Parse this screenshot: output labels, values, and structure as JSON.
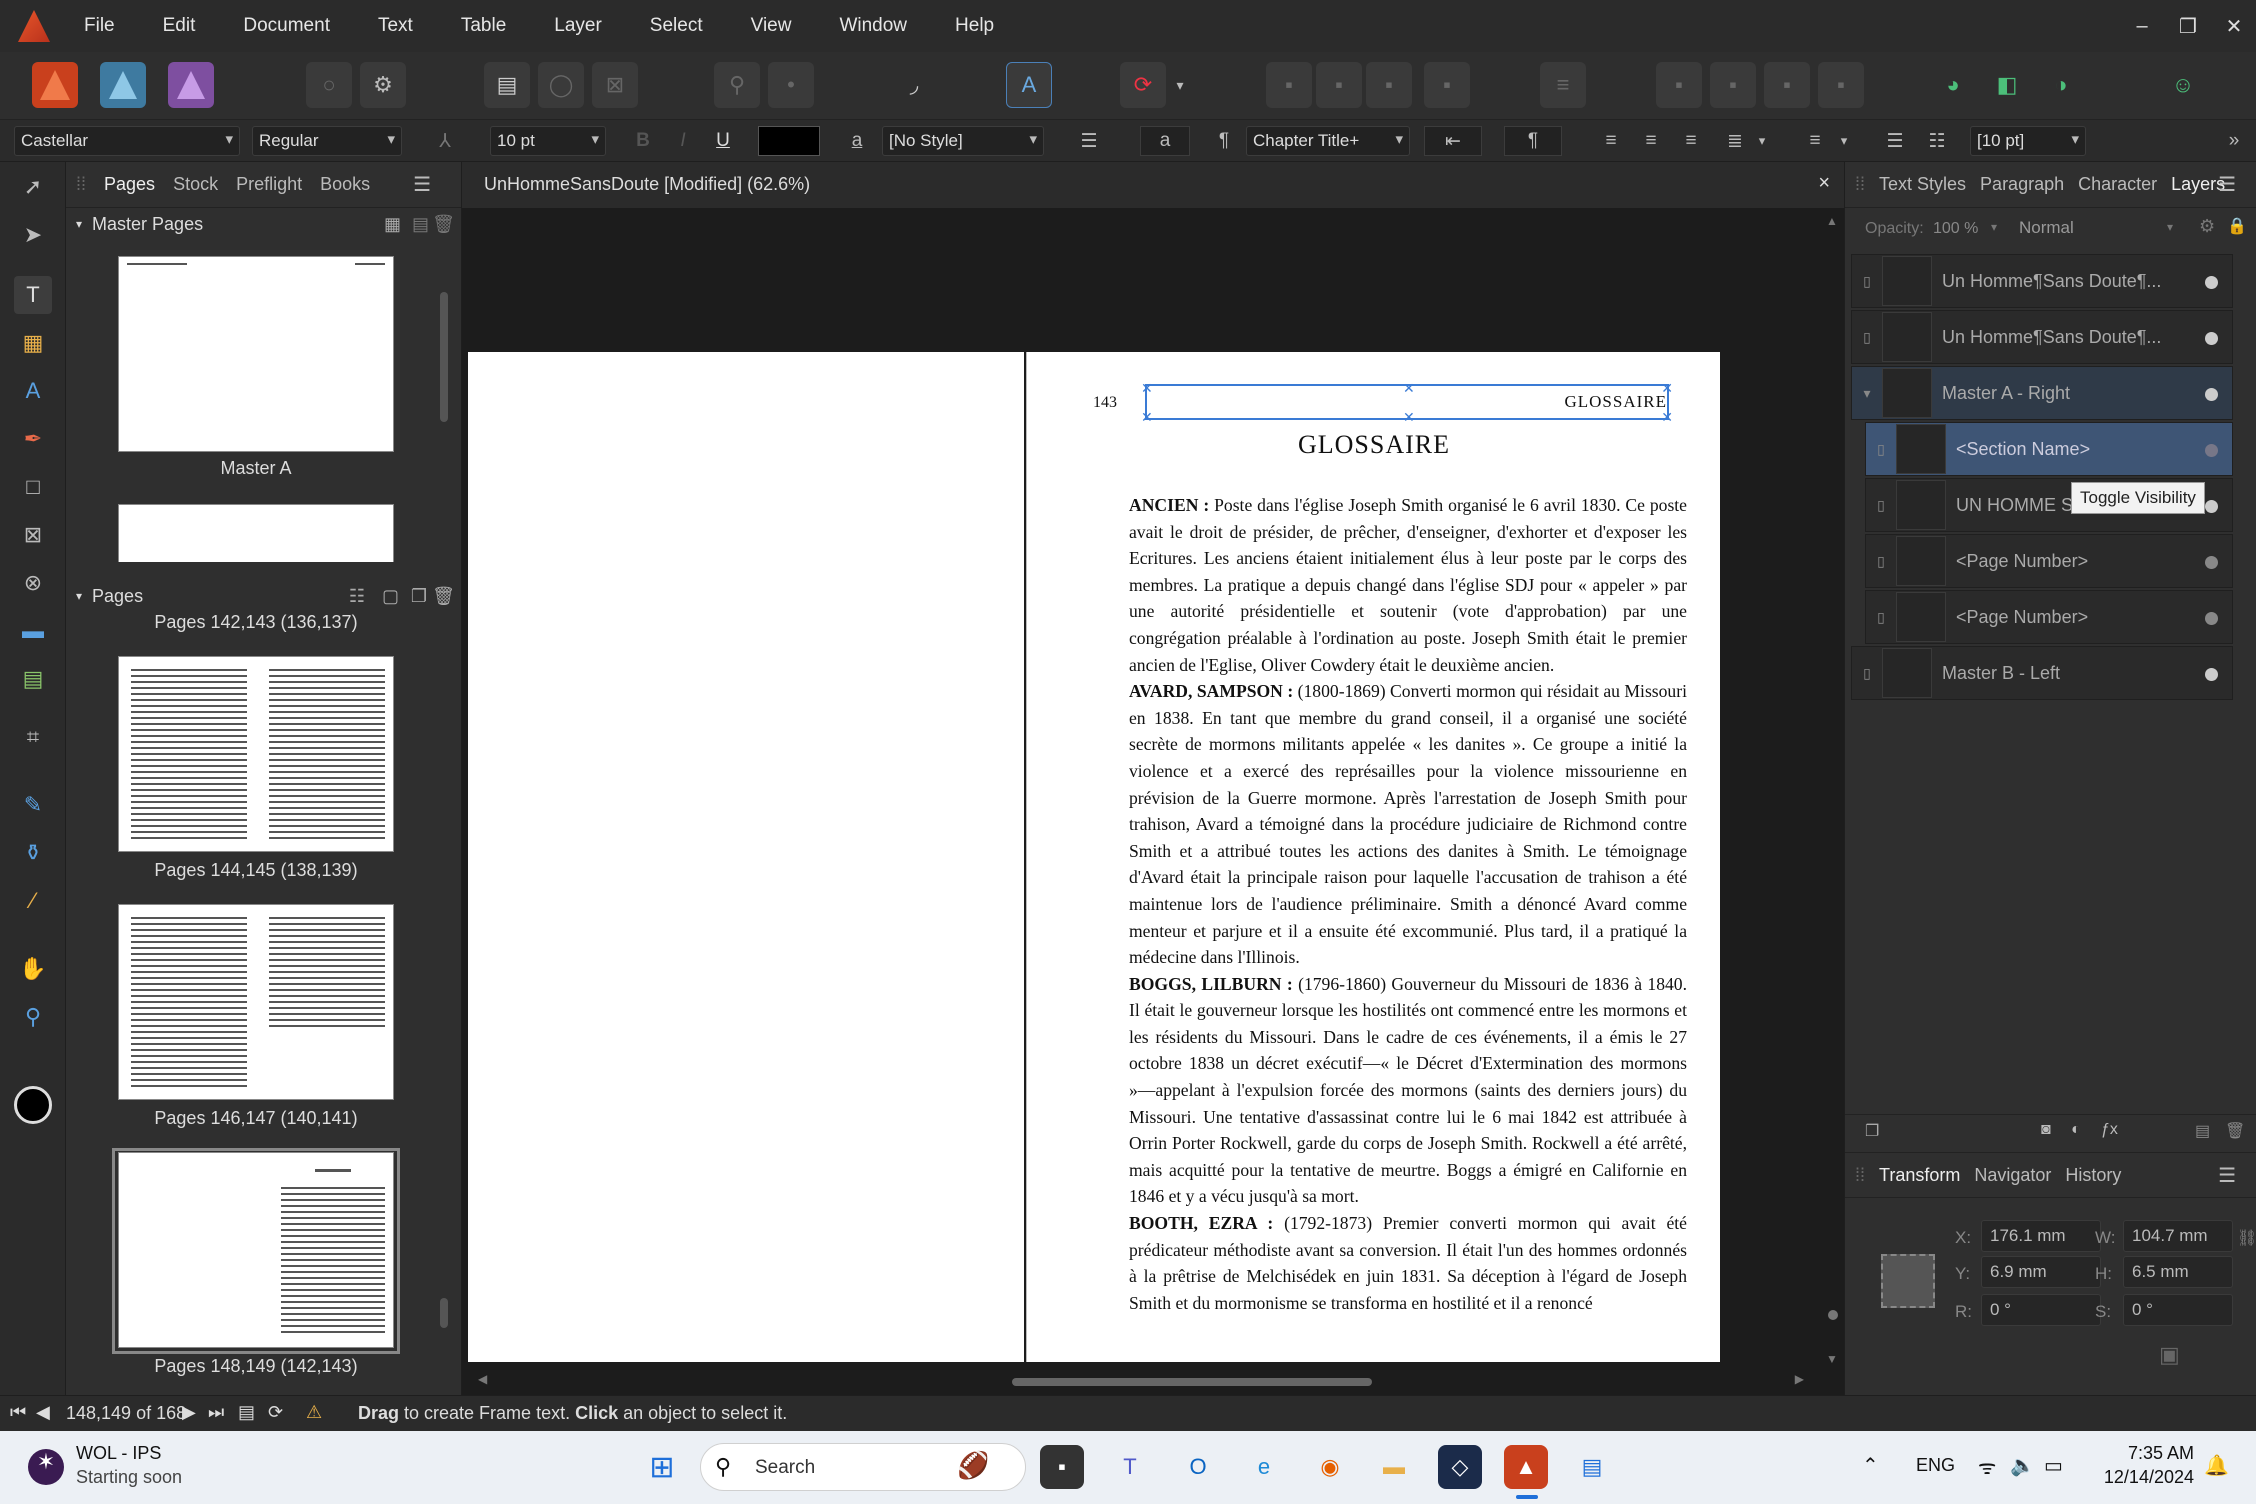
{
  "menubar": {
    "items": [
      "File",
      "Edit",
      "Document",
      "Text",
      "Table",
      "Layer",
      "Select",
      "View",
      "Window",
      "Help"
    ]
  },
  "context": {
    "font": "Castellar",
    "style": "Regular",
    "size": "10 pt",
    "text_style": "[No Style]",
    "para_style": "Chapter Title+",
    "leading": "[10 pt]",
    "bold": "B",
    "italic": "I",
    "underline": "U",
    "a_glyph": "a",
    "pilcrow": "¶"
  },
  "pages_panel": {
    "tabs": [
      "Pages",
      "Stock",
      "Preflight",
      "Books"
    ],
    "master_header": "Master Pages",
    "master_a": "Master A",
    "pages_header": "Pages",
    "partial_label": "Pages 142,143 (136,137)",
    "spreads": [
      "Pages 144,145 (138,139)",
      "Pages 146,147 (140,141)",
      "Pages 148,149 (142,143)"
    ]
  },
  "document": {
    "tab_title": "UnHommeSansDoute [Modified] (62.6%)",
    "close": "×",
    "page_number": "143",
    "running_header": "GLOSSAIRE",
    "chapter_title": "GLOSSAIRE",
    "entries": [
      {
        "term": "ANCIEN :",
        "text": " Poste dans l'église Joseph Smith organisé le 6 avril 1830. Ce poste avait le droit de présider, de prêcher, d'enseigner, d'exhorter et d'exposer les Ecritures. Les anciens étaient initialement élus à leur poste par le corps des membres. La pratique a depuis changé dans l'église SDJ pour « appeler » par une autorité présidentielle et soutenir (vote d'approbation) par une congrégation préalable à l'ordination au poste. Joseph Smith était le premier ancien de l'Eglise, Oliver Cowdery était le deuxième ancien."
      },
      {
        "term": "AVARD, SAMPSON :",
        "text": " (1800-1869) Converti mormon qui résidait au Missouri en 1838. En tant que membre du grand conseil, il a organisé une société secrète de mormons militants appelée « les danites ». Ce groupe a initié la violence et a exercé des représailles pour la violence missourienne en prévision de la Guerre mormone. Après l'arrestation de Joseph Smith pour trahison, Avard a témoigné dans la procédure judiciaire de Richmond contre Smith et a attribué toutes les actions des danites à Smith. Le témoignage d'Avard était la principale raison pour laquelle l'accusation de trahison a été maintenue lors de l'audience préliminaire. Smith a dénoncé Avard comme menteur et parjure et il a ensuite été excommunié. Plus tard, il a pratiqué la médecine dans l'Illinois."
      },
      {
        "term": "BOGGS, LILBURN :",
        "text": " (1796-1860) Gouverneur du Missouri de 1836 à 1840. Il était le gouverneur lorsque les hostilités ont commencé entre les mormons et les résidents du Missouri. Dans le cadre de ces événements, il a émis le 27 octobre 1838 un décret exécutif—« le Décret d'Extermination des mormons »—appelant à l'expulsion forcée des mormons (saints des derniers jours) du Missouri. Une tentative d'assassinat contre lui le 6 mai 1842 est attribuée à Orrin Porter Rockwell, garde du corps de Joseph Smith. Rockwell a été arrêté, mais acquitté pour la tentative de meurtre. Boggs a émigré en Californie en 1846 et y a vécu jusqu'à sa mort."
      },
      {
        "term": "BOOTH, EZRA :",
        "text": " (1792-1873) Premier converti mormon qui avait été prédicateur méthodiste avant sa conversion. Il était l'un des hommes ordonnés à la prêtrise de Melchisédek en juin 1831. Sa déception à l'égard de Joseph Smith et du mormonisme se transforma en hostilité et il a renoncé"
      }
    ]
  },
  "right_panel": {
    "tabs": [
      "Text Styles",
      "Paragraph",
      "Character",
      "Layers"
    ],
    "opacity_label": "Opacity:",
    "opacity": "100 %",
    "blend": "Normal",
    "layers": [
      "Un Homme¶Sans Doute¶...",
      "Un Homme¶Sans Doute¶...",
      "Master A - Right",
      "<Section Name>",
      "UN HOMME S",
      "<Page Number>",
      "<Page Number>",
      "Master B - Left"
    ],
    "tooltip": "Toggle Visibility",
    "lower_tabs": [
      "Transform",
      "Navigator",
      "History"
    ],
    "transform": {
      "x_label": "X:",
      "x": "176.1 mm",
      "w_label": "W:",
      "w": "104.7 mm",
      "y_label": "Y:",
      "y": "6.9 mm",
      "h_label": "H:",
      "h": "6.5 mm",
      "r_label": "R:",
      "r": "0 °",
      "s_label": "S:",
      "s": "0 °"
    }
  },
  "status": {
    "page": "148,149 of 168",
    "drag": "Drag",
    "hint1": " to create Frame text. ",
    "click": "Click",
    "hint2": " an object to select it."
  },
  "taskbar": {
    "widget_title": "WOL - IPS",
    "widget_sub": "Starting soon",
    "search": "Search",
    "lang": "ENG",
    "time": "7:35 AM",
    "date": "12/14/2024"
  },
  "colors": {
    "accent": "#3e5575",
    "app": "#e8562a",
    "selection_frame": "#3a7bd5"
  }
}
